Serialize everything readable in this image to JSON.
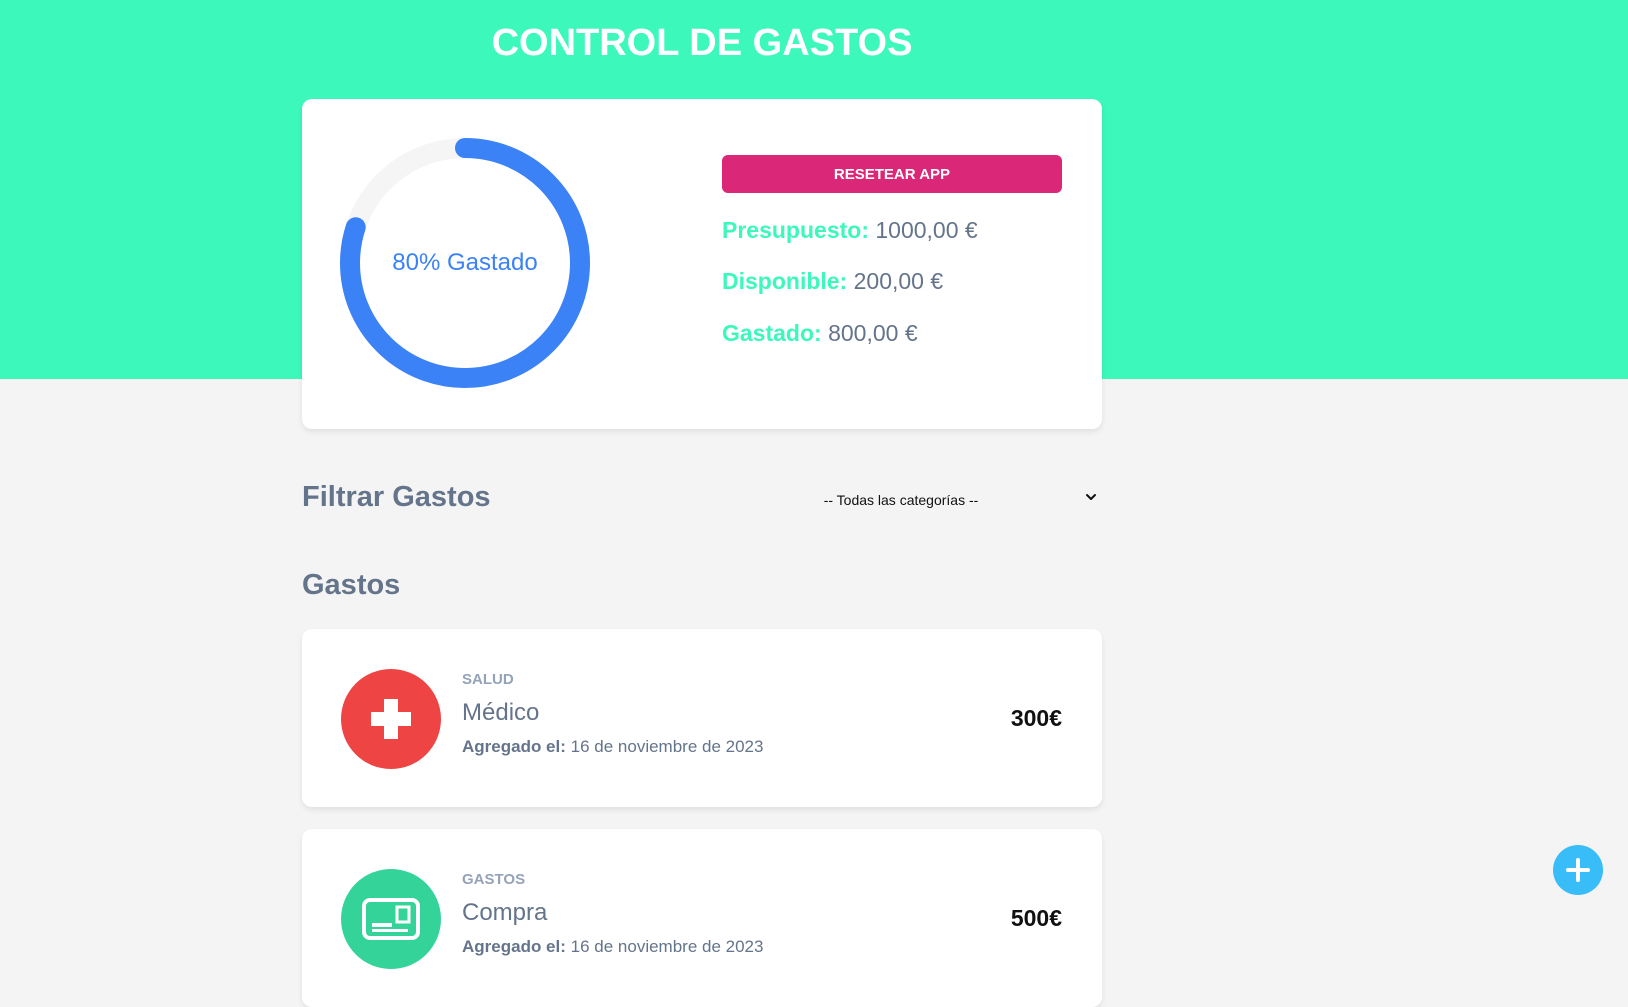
{
  "header": {
    "title": "CONTROL DE GASTOS"
  },
  "budget": {
    "percent_spent": 80,
    "donut_label": "80% Gastado",
    "reset_label": "RESETEAR APP",
    "stats": [
      {
        "label": "Presupuesto:",
        "value": "1000,00 €"
      },
      {
        "label": "Disponible:",
        "value": "200,00 €"
      },
      {
        "label": "Gastado:",
        "value": "800,00 €"
      }
    ],
    "colors": {
      "progress": "#3b82f6",
      "track": "#f5f5f5"
    }
  },
  "filter": {
    "title": "Filtrar Gastos",
    "selected": "-- Todas las categorías --"
  },
  "expenses": {
    "title": "Gastos",
    "items": [
      {
        "category": "SALUD",
        "name": "Médico",
        "date_label": "Agregado el:",
        "date": "16 de noviembre de 2023",
        "amount": "300€",
        "icon": "medical-cross-icon",
        "icon_color": "#ef4444"
      },
      {
        "category": "GASTOS",
        "name": "Compra",
        "date_label": "Agregado el:",
        "date": "16 de noviembre de 2023",
        "amount": "500€",
        "icon": "card-icon",
        "icon_color": "#34d399"
      }
    ]
  },
  "fab": {
    "icon": "plus-icon",
    "color": "#38bdf8"
  }
}
